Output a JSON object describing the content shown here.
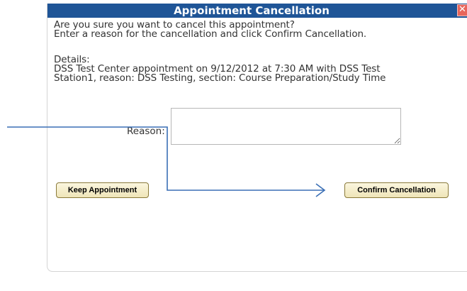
{
  "dialog": {
    "title": "Appointment Cancellation",
    "close_symbol": "✕",
    "close_icon": "close-icon",
    "titlebar_color": "#1f5597",
    "close_color": "#e8665c",
    "lines": [
      "Are you sure you want to cancel this appointment?",
      "Enter a reason for the cancellation and click Confirm Cancellation.",
      "Details:",
      "DSS Test Center appointment on 9/12/2012 at 7:30 AM with DSS Test",
      "Station1, reason: DSS Testing, section: Course Preparation/Study Time"
    ],
    "reason_label": "Reason:",
    "reason_value": "",
    "keep_button": "Keep Appointment",
    "confirm_button": "Confirm Cancellation"
  },
  "annotation": {
    "arrow_color": "#3a6fb5",
    "arrow_icon": "arrow-icon"
  }
}
